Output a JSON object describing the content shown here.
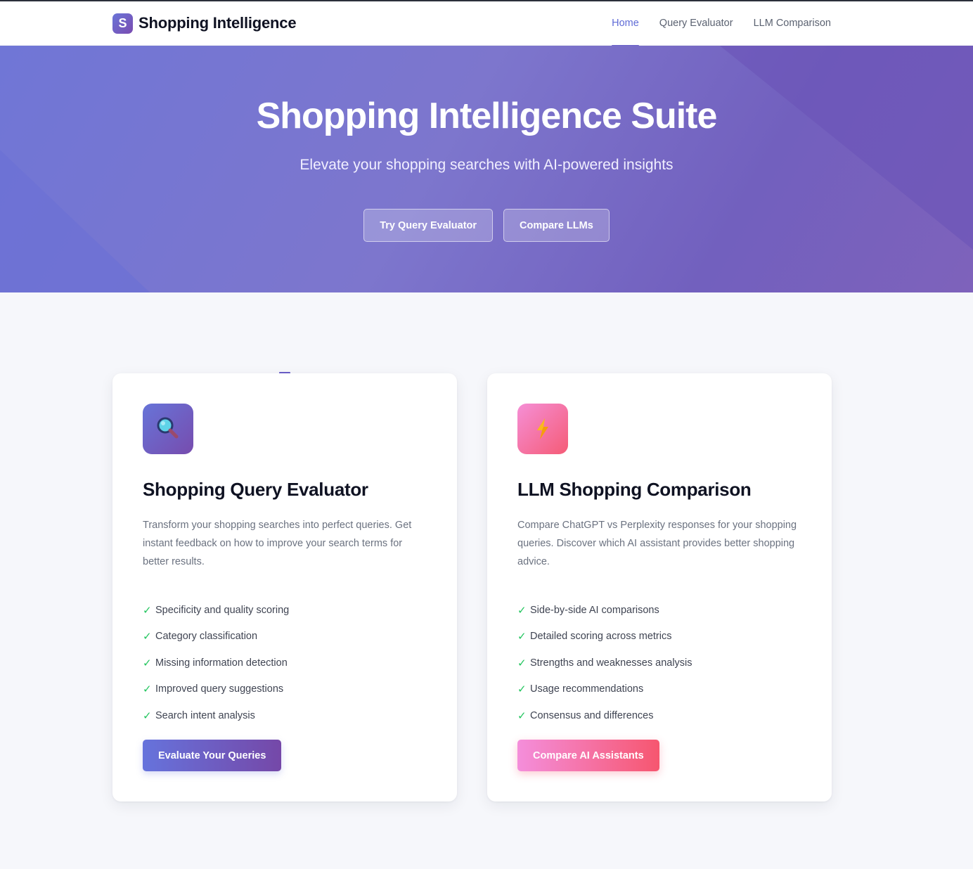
{
  "navbar": {
    "brand_letter": "S",
    "brand_name": "Shopping Intelligence",
    "links": [
      {
        "label": "Home",
        "active": true
      },
      {
        "label": "Query Evaluator",
        "active": false
      },
      {
        "label": "LLM Comparison",
        "active": false
      }
    ]
  },
  "hero": {
    "title": "Shopping Intelligence Suite",
    "subtitle": "Elevate your shopping searches with AI-powered insights",
    "buttons": [
      "Try Query Evaluator",
      "Compare LLMs"
    ]
  },
  "cards": [
    {
      "icon": "magnifying-glass-icon",
      "title": "Shopping Query Evaluator",
      "description": "Transform your shopping searches into perfect queries. Get instant feedback on how to improve your search terms for better results.",
      "features": [
        "Specificity and quality scoring",
        "Category classification",
        "Missing information detection",
        "Improved query suggestions",
        "Search intent analysis"
      ],
      "button": "Evaluate Your Queries"
    },
    {
      "icon": "lightning-bolt-icon",
      "title": "LLM Shopping Comparison",
      "description": "Compare ChatGPT vs Perplexity responses for your shopping queries. Discover which AI assistant provides better shopping advice.",
      "features": [
        "Side-by-side AI comparisons",
        "Detailed scoring across metrics",
        "Strengths and weaknesses analysis",
        "Usage recommendations",
        "Consensus and differences"
      ],
      "button": "Compare AI Assistants"
    }
  ],
  "check_glyph": "✓",
  "colors": {
    "accent": "#5f6bd6",
    "check": "#22c55e",
    "hero_start": "#7076d6",
    "hero_end": "#7e62bb",
    "pink_start": "#f48edb",
    "pink_end": "#f6566f"
  }
}
